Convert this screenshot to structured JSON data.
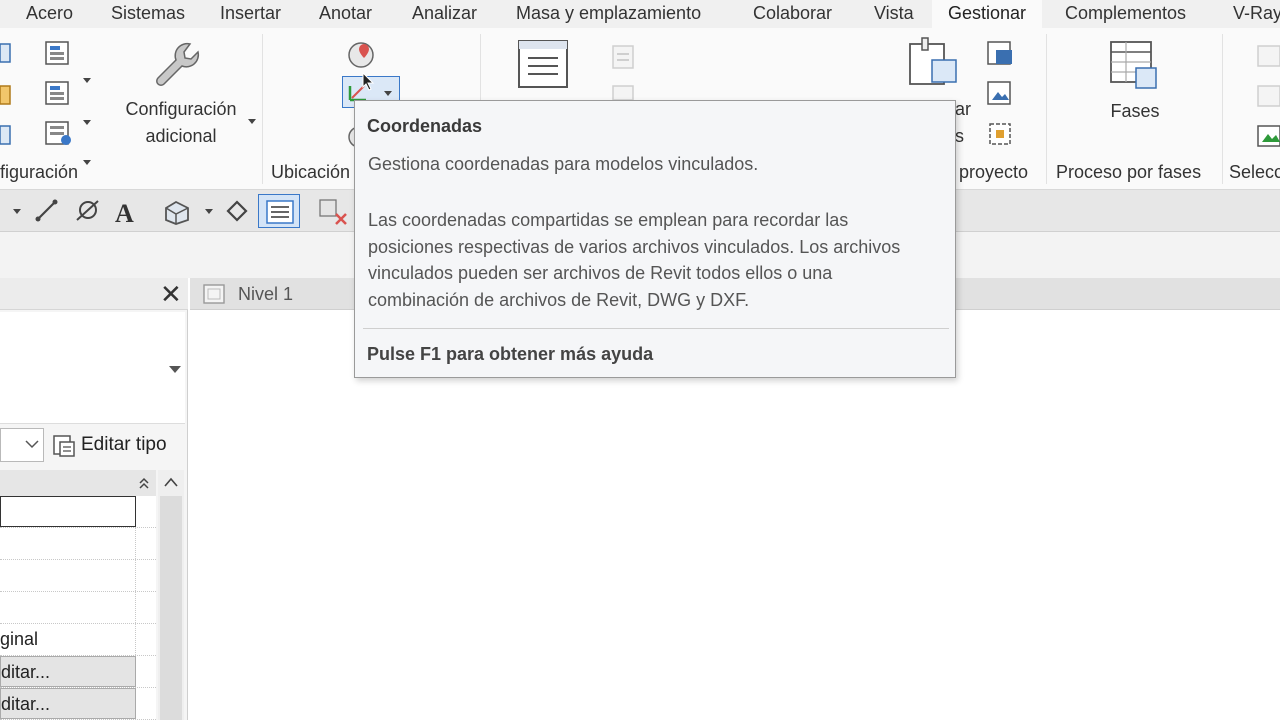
{
  "tabs": [
    "Acero",
    "Sistemas",
    "Insertar",
    "Anotar",
    "Analizar",
    "Masa y emplazamiento",
    "Colaborar",
    "Vista",
    "Gestionar",
    "Complementos",
    "V-Ray"
  ],
  "active_tab": "Gestionar",
  "ribbon": {
    "config_label_line1": "Configuración",
    "config_label_line2": "adicional",
    "panel_configuracion": "figuración",
    "panel_ubicacion": "Ubicación",
    "partial_label_1": "ar",
    "partial_label_2": "s",
    "panel_proyecto": "proyecto",
    "fases_label": "Fases",
    "panel_proceso_fases": "Proceso por fases",
    "panel_seleccion": "Selecc"
  },
  "properties": {
    "edit_type_label": "Editar tipo",
    "rows": [
      {
        "text": ""
      },
      {
        "text": ""
      },
      {
        "text": ""
      },
      {
        "text": ""
      },
      {
        "text": "ginal"
      },
      {
        "text": "ditar..."
      },
      {
        "text": "ditar..."
      }
    ]
  },
  "view_tab": {
    "label": "Nivel 1"
  },
  "tooltip": {
    "title": "Coordenadas",
    "summary": "Gestiona coordenadas para modelos vinculados.",
    "description_lines": [
      "Las coordenadas compartidas se emplean para recordar las",
      "posiciones respectivas de varios archivos vinculados. Los archivos",
      "vinculados pueden ser archivos de Revit todos ellos o una",
      "combinación de archivos de Revit, DWG y DXF."
    ],
    "help": "Pulse F1 para obtener más ayuda"
  },
  "colors": {
    "selected_tool_border": "#3a78c8",
    "tooltip_bg": "#f5f6f8",
    "accent_red": "#d9534f"
  }
}
